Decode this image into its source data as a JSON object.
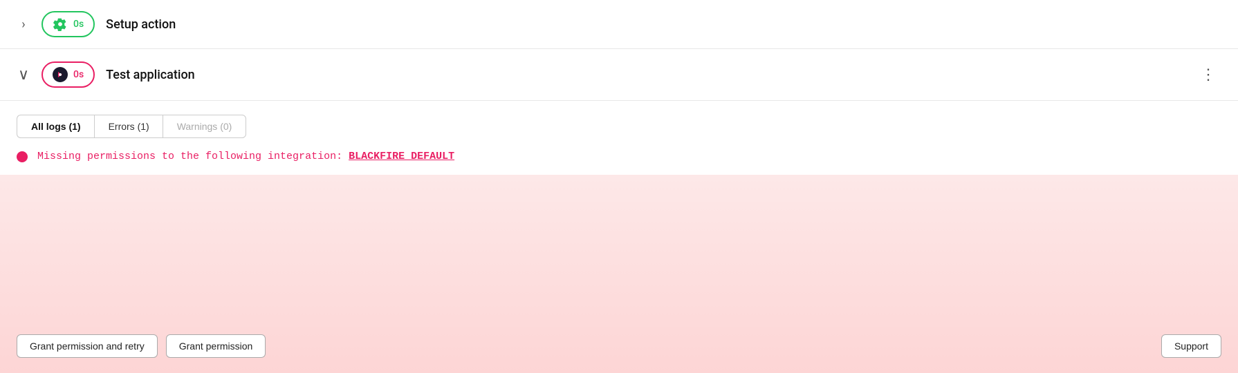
{
  "setup_action": {
    "title": "Setup action",
    "duration": "0s",
    "chevron": "›",
    "badge_type": "green"
  },
  "test_application": {
    "title": "Test application",
    "duration": "0s",
    "chevron": "∨",
    "badge_type": "red",
    "more_icon": "⋮"
  },
  "tabs": [
    {
      "label": "All logs (1)",
      "active": true
    },
    {
      "label": "Errors (1)",
      "active": false
    },
    {
      "label": "Warnings (0)",
      "active": false,
      "disabled": true
    }
  ],
  "error": {
    "message_prefix": "Missing permissions to the following integration: ",
    "integration_name": "BLACKFIRE_DEFAULT"
  },
  "actions": {
    "grant_and_retry": "Grant permission and retry",
    "grant": "Grant permission",
    "support": "Support"
  }
}
